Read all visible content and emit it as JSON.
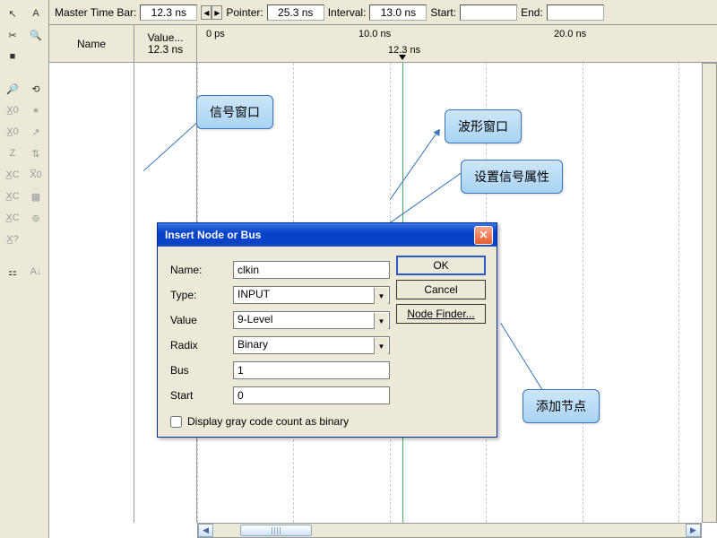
{
  "timebar": {
    "master_label": "Master Time Bar:",
    "master_value": "12.3 ns",
    "pointer_label": "Pointer:",
    "pointer_value": "25.3 ns",
    "interval_label": "Interval:",
    "interval_value": "13.0 ns",
    "start_label": "Start:",
    "start_value": "",
    "end_label": "End:",
    "end_value": ""
  },
  "tool_icons": [
    "↖",
    "A",
    "✂",
    "🔍",
    "■",
    "",
    "🔎",
    "⟲",
    "X̲0",
    "✶",
    "X̲0",
    "↗",
    "Z",
    "⇅",
    "X̲C",
    "X̅0",
    "X̲C",
    "▦",
    "X̲C",
    "⊚",
    "X̲?",
    "",
    "⚏",
    "A↓"
  ],
  "header": {
    "name_col": "Name",
    "value_col_top": "Value...",
    "value_col_bottom": "12.3 ns",
    "ticks": [
      {
        "pos": 10,
        "text": "0 ps"
      },
      {
        "pos": 180,
        "text": "10.0 ns"
      },
      {
        "pos": 398,
        "text": "20.0 ns"
      }
    ],
    "cursor_label": "12.3 ns"
  },
  "gridlines_x": [
    0,
    107,
    215,
    322,
    430,
    537
  ],
  "dialog": {
    "title": "Insert Node or Bus",
    "fields": {
      "name": {
        "label": "Name:",
        "value": "clkin"
      },
      "type": {
        "label": "Type:",
        "value": "INPUT"
      },
      "value": {
        "label": "Value",
        "value": "9-Level"
      },
      "radix": {
        "label": "Radix",
        "value": "Binary"
      },
      "bus": {
        "label": "Bus",
        "value": "1"
      },
      "start": {
        "label": "Start",
        "value": "0"
      }
    },
    "buttons": {
      "ok": "OK",
      "cancel": "Cancel",
      "nodefinder": "Node Finder..."
    },
    "checkbox": "Display gray code count as binary"
  },
  "callouts": {
    "signal": "信号窗口",
    "wave": "波形窗口",
    "attr": "设置信号属性",
    "addnode": "添加节点"
  }
}
